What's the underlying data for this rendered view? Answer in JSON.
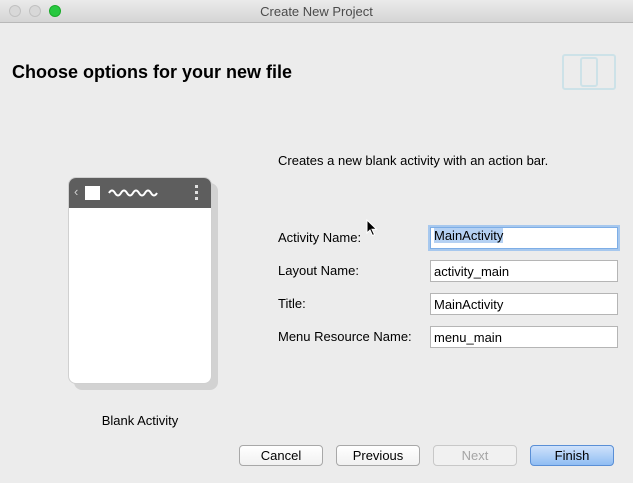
{
  "window": {
    "title": "Create New Project"
  },
  "header": {
    "title": "Choose options for your new file",
    "icon": "device-icon"
  },
  "template": {
    "label": "Blank Activity"
  },
  "description": "Creates a new blank activity with an action bar.",
  "fields": [
    {
      "label": "Activity Name:",
      "value": "MainActivity"
    },
    {
      "label": "Layout Name:",
      "value": "activity_main"
    },
    {
      "label": "Title:",
      "value": "MainActivity"
    },
    {
      "label": "Menu Resource Name:",
      "value": "menu_main"
    }
  ],
  "buttons": {
    "cancel": "Cancel",
    "previous": "Previous",
    "next": "Next",
    "finish": "Finish"
  },
  "colors": {
    "accent": "#7eaee6",
    "primary_button": "#90bdf3",
    "zoom_button": "#28c840"
  }
}
